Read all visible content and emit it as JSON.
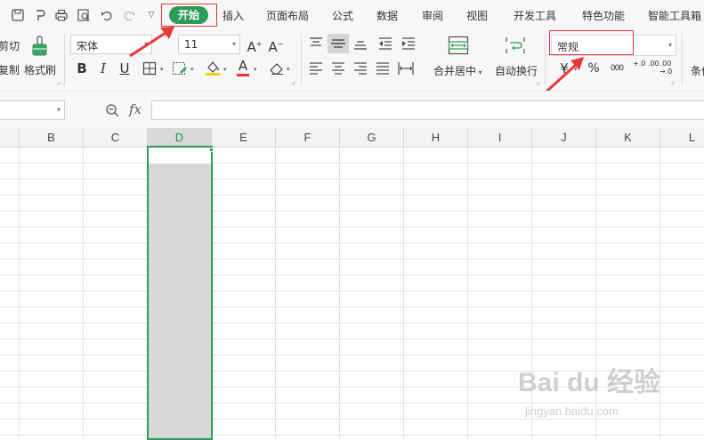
{
  "menubar": {
    "tabs": [
      "开始",
      "插入",
      "页面布局",
      "公式",
      "数据",
      "审阅",
      "视图",
      "开发工具",
      "特色功能",
      "智能工具箱"
    ],
    "active_tab": "开始"
  },
  "ribbon": {
    "cut_label": "剪切",
    "copy_label": "复制",
    "format_painter_label": "格式刷",
    "font_name": "宋体",
    "font_size": "11",
    "grow_font": "A",
    "shrink_font": "A",
    "bold": "B",
    "italic": "I",
    "underline": "U",
    "font_color_letter": "A",
    "merge_center_label": "合并居中",
    "wrap_text_label": "自动换行",
    "number_format": "常规",
    "currency_symbol": "¥",
    "percent_symbol": "%",
    "thousands_symbol": "000",
    "increase_decimal": "+.0 .00",
    "decrease_decimal": ".00 →.0",
    "conditional_label": "条件"
  },
  "formula_bar": {
    "fx_label": "fx",
    "value": ""
  },
  "grid": {
    "columns": [
      "B",
      "C",
      "D",
      "E",
      "F",
      "G",
      "H",
      "I",
      "J",
      "K",
      "L"
    ],
    "selected_column": "D"
  },
  "watermark": {
    "brand": "Bai du 经验",
    "url": "jingyan.baidu.com"
  },
  "colors": {
    "accent": "#2e9b5a",
    "annotation": "#e53935",
    "selection_fill": "#d8d8d8"
  }
}
